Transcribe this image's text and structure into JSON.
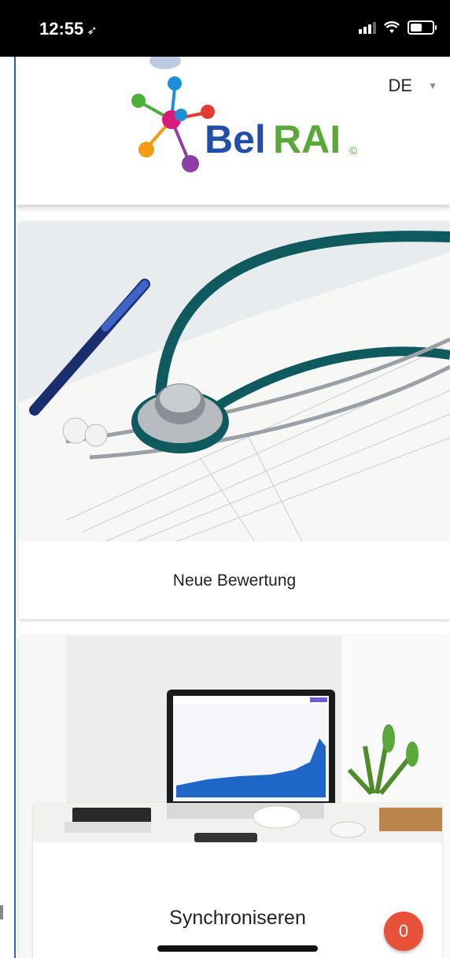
{
  "status_bar": {
    "time": "12:55",
    "location_glyph": "➶"
  },
  "header": {
    "brand_bel": "Bel",
    "brand_rai": "RAI",
    "brand_mark": "©",
    "language": "DE",
    "language_caret": "▼"
  },
  "cards": [
    {
      "label": "Neue Bewertung",
      "image": "stethoscope-on-papers"
    },
    {
      "label": "",
      "image": "laptop-dashboard"
    },
    {
      "label": "Synchroniseren",
      "image": "desk-with-keyboard"
    }
  ],
  "sync_badge": {
    "count": "0"
  },
  "colors": {
    "brand_blue": "#1f4fa8",
    "brand_green": "#5aa83a",
    "badge_red": "#e8523a",
    "frame_blue": "#2a6ca0"
  }
}
